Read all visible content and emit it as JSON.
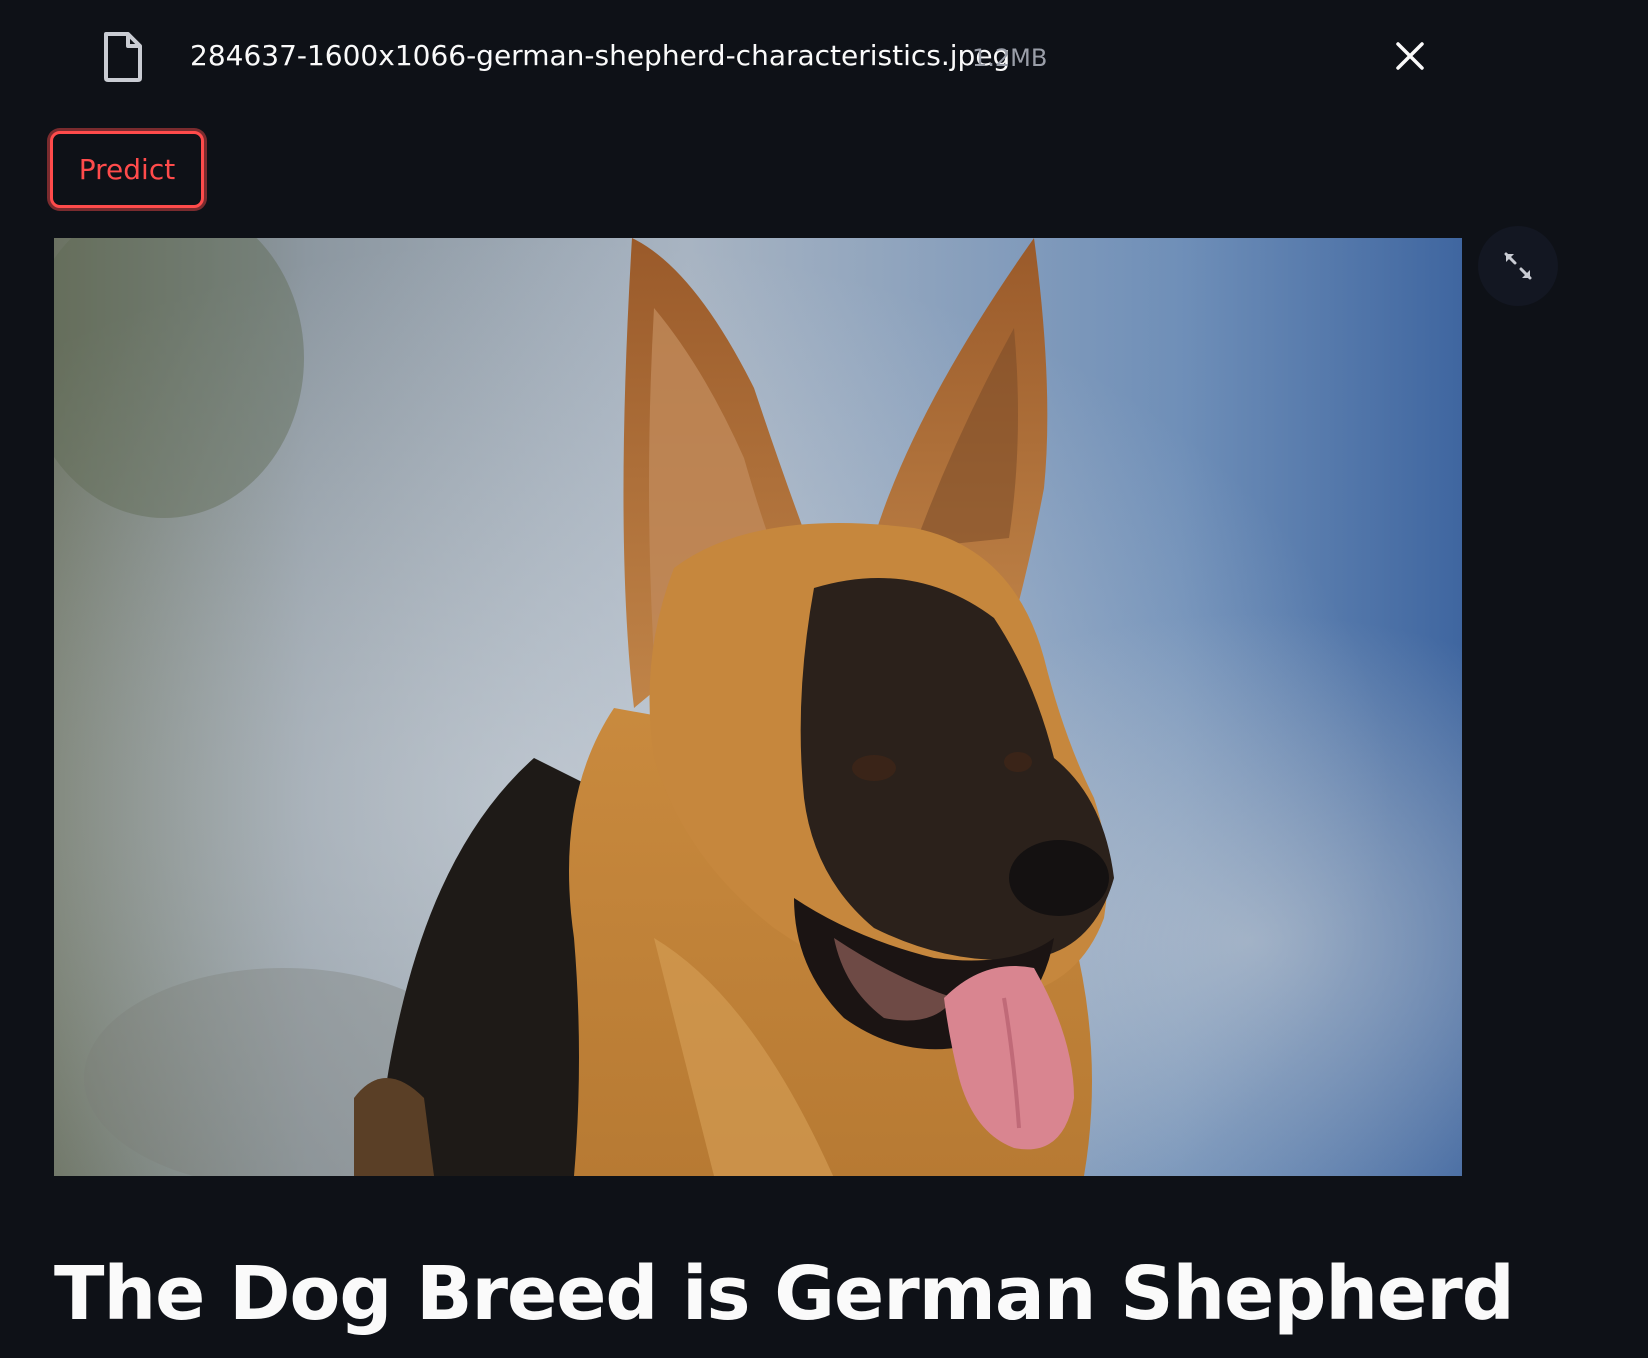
{
  "upload": {
    "file_icon": "file-icon",
    "file_name": "284637-1600x1066-german-shepherd-characteristics.jpeg",
    "file_size": "1.2MB",
    "close_icon": "close-icon"
  },
  "actions": {
    "predict_label": "Predict"
  },
  "image": {
    "subject": "german-shepherd-photo",
    "fullscreen_icon": "expand-icon"
  },
  "result": {
    "heading": "The Dog Breed is German Shepherd"
  },
  "colors": {
    "background": "#0e1117",
    "accent": "#ff4b4b",
    "text": "#fafafa",
    "muted": "#9a9ea8"
  }
}
